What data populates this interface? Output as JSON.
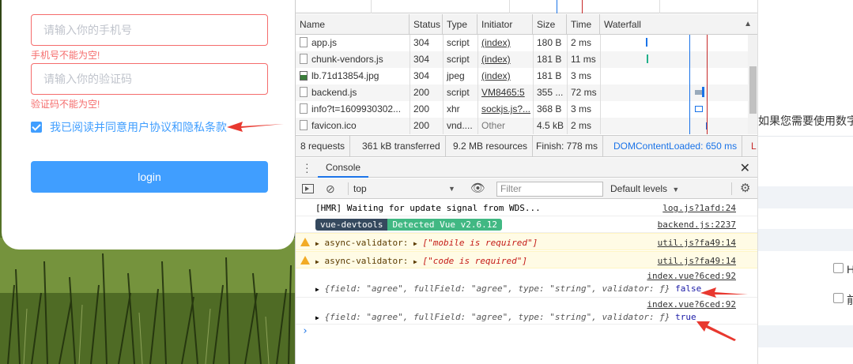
{
  "login": {
    "phone_placeholder": "请输入你的手机号",
    "phone_error": "手机号不能为空!",
    "code_placeholder": "请输入你的验证码",
    "code_error": "验证码不能为空!",
    "agree_label": "我已阅读并同意用户协议和隐私条款",
    "agree_checked": true,
    "login_button": "login"
  },
  "network": {
    "columns": [
      "Name",
      "Status",
      "Type",
      "Initiator",
      "Size",
      "Time",
      "Waterfall"
    ],
    "rows": [
      {
        "name": "app.js",
        "status": "304",
        "type": "script",
        "initiator": "(index)",
        "size": "180 B",
        "time": "2 ms"
      },
      {
        "name": "chunk-vendors.js",
        "status": "304",
        "type": "script",
        "initiator": "(index)",
        "size": "181 B",
        "time": "11 ms"
      },
      {
        "name": "lb.71d13854.jpg",
        "status": "304",
        "type": "jpeg",
        "initiator": "(index)",
        "size": "181 B",
        "time": "3 ms"
      },
      {
        "name": "backend.js",
        "status": "200",
        "type": "script",
        "initiator": "VM8465:5",
        "size": "355 ...",
        "time": "72 ms"
      },
      {
        "name": "info?t=1609930302...",
        "status": "200",
        "type": "xhr",
        "initiator": "sockjs.js?...",
        "size": "368 B",
        "time": "3 ms"
      },
      {
        "name": "favicon.ico",
        "status": "200",
        "type": "vnd....",
        "initiator": "Other",
        "size": "4.5 kB",
        "time": "2 ms"
      }
    ],
    "summary": {
      "requests": "8 requests",
      "transferred": "361 kB transferred",
      "resources": "9.2 MB resources",
      "finish": "Finish: 778 ms",
      "dcl": "DOMContentLoaded: 650 ms",
      "load": "L"
    }
  },
  "drawer": {
    "tab": "Console",
    "context": "top",
    "filter_placeholder": "Filter",
    "levels": "Default levels"
  },
  "console": {
    "lines": [
      {
        "text": "[HMR] Waiting for update signal from WDS...",
        "source": "log.js?1afd:24"
      },
      {
        "badge1": "vue-devtools",
        "badge2": "Detected Vue v2.6.12",
        "source": "backend.js:2237"
      },
      {
        "prefix": "async-validator:",
        "value": "[\"mobile is required\"]",
        "source": "util.js?fa49:14"
      },
      {
        "prefix": "async-validator:",
        "value": "[\"code is required\"]",
        "source": "util.js?fa49:14"
      },
      {
        "source": "index.vue?6ced:92",
        "obj": "{field: \"agree\", fullField: \"agree\", type: \"string\", validator: ƒ}",
        "value": "false"
      },
      {
        "source": "index.vue?6ced:92",
        "obj": "{field: \"agree\", fullField: \"agree\", type: \"string\", validator: ƒ}",
        "value": "true"
      }
    ],
    "prompt": "›"
  },
  "right_page": {
    "text1": "如果您需要使用数字",
    "label1": "H",
    "label2": "前"
  },
  "colors": {
    "error": "#f56c6c",
    "primary": "#409eff",
    "arrow": "#e8382f"
  }
}
